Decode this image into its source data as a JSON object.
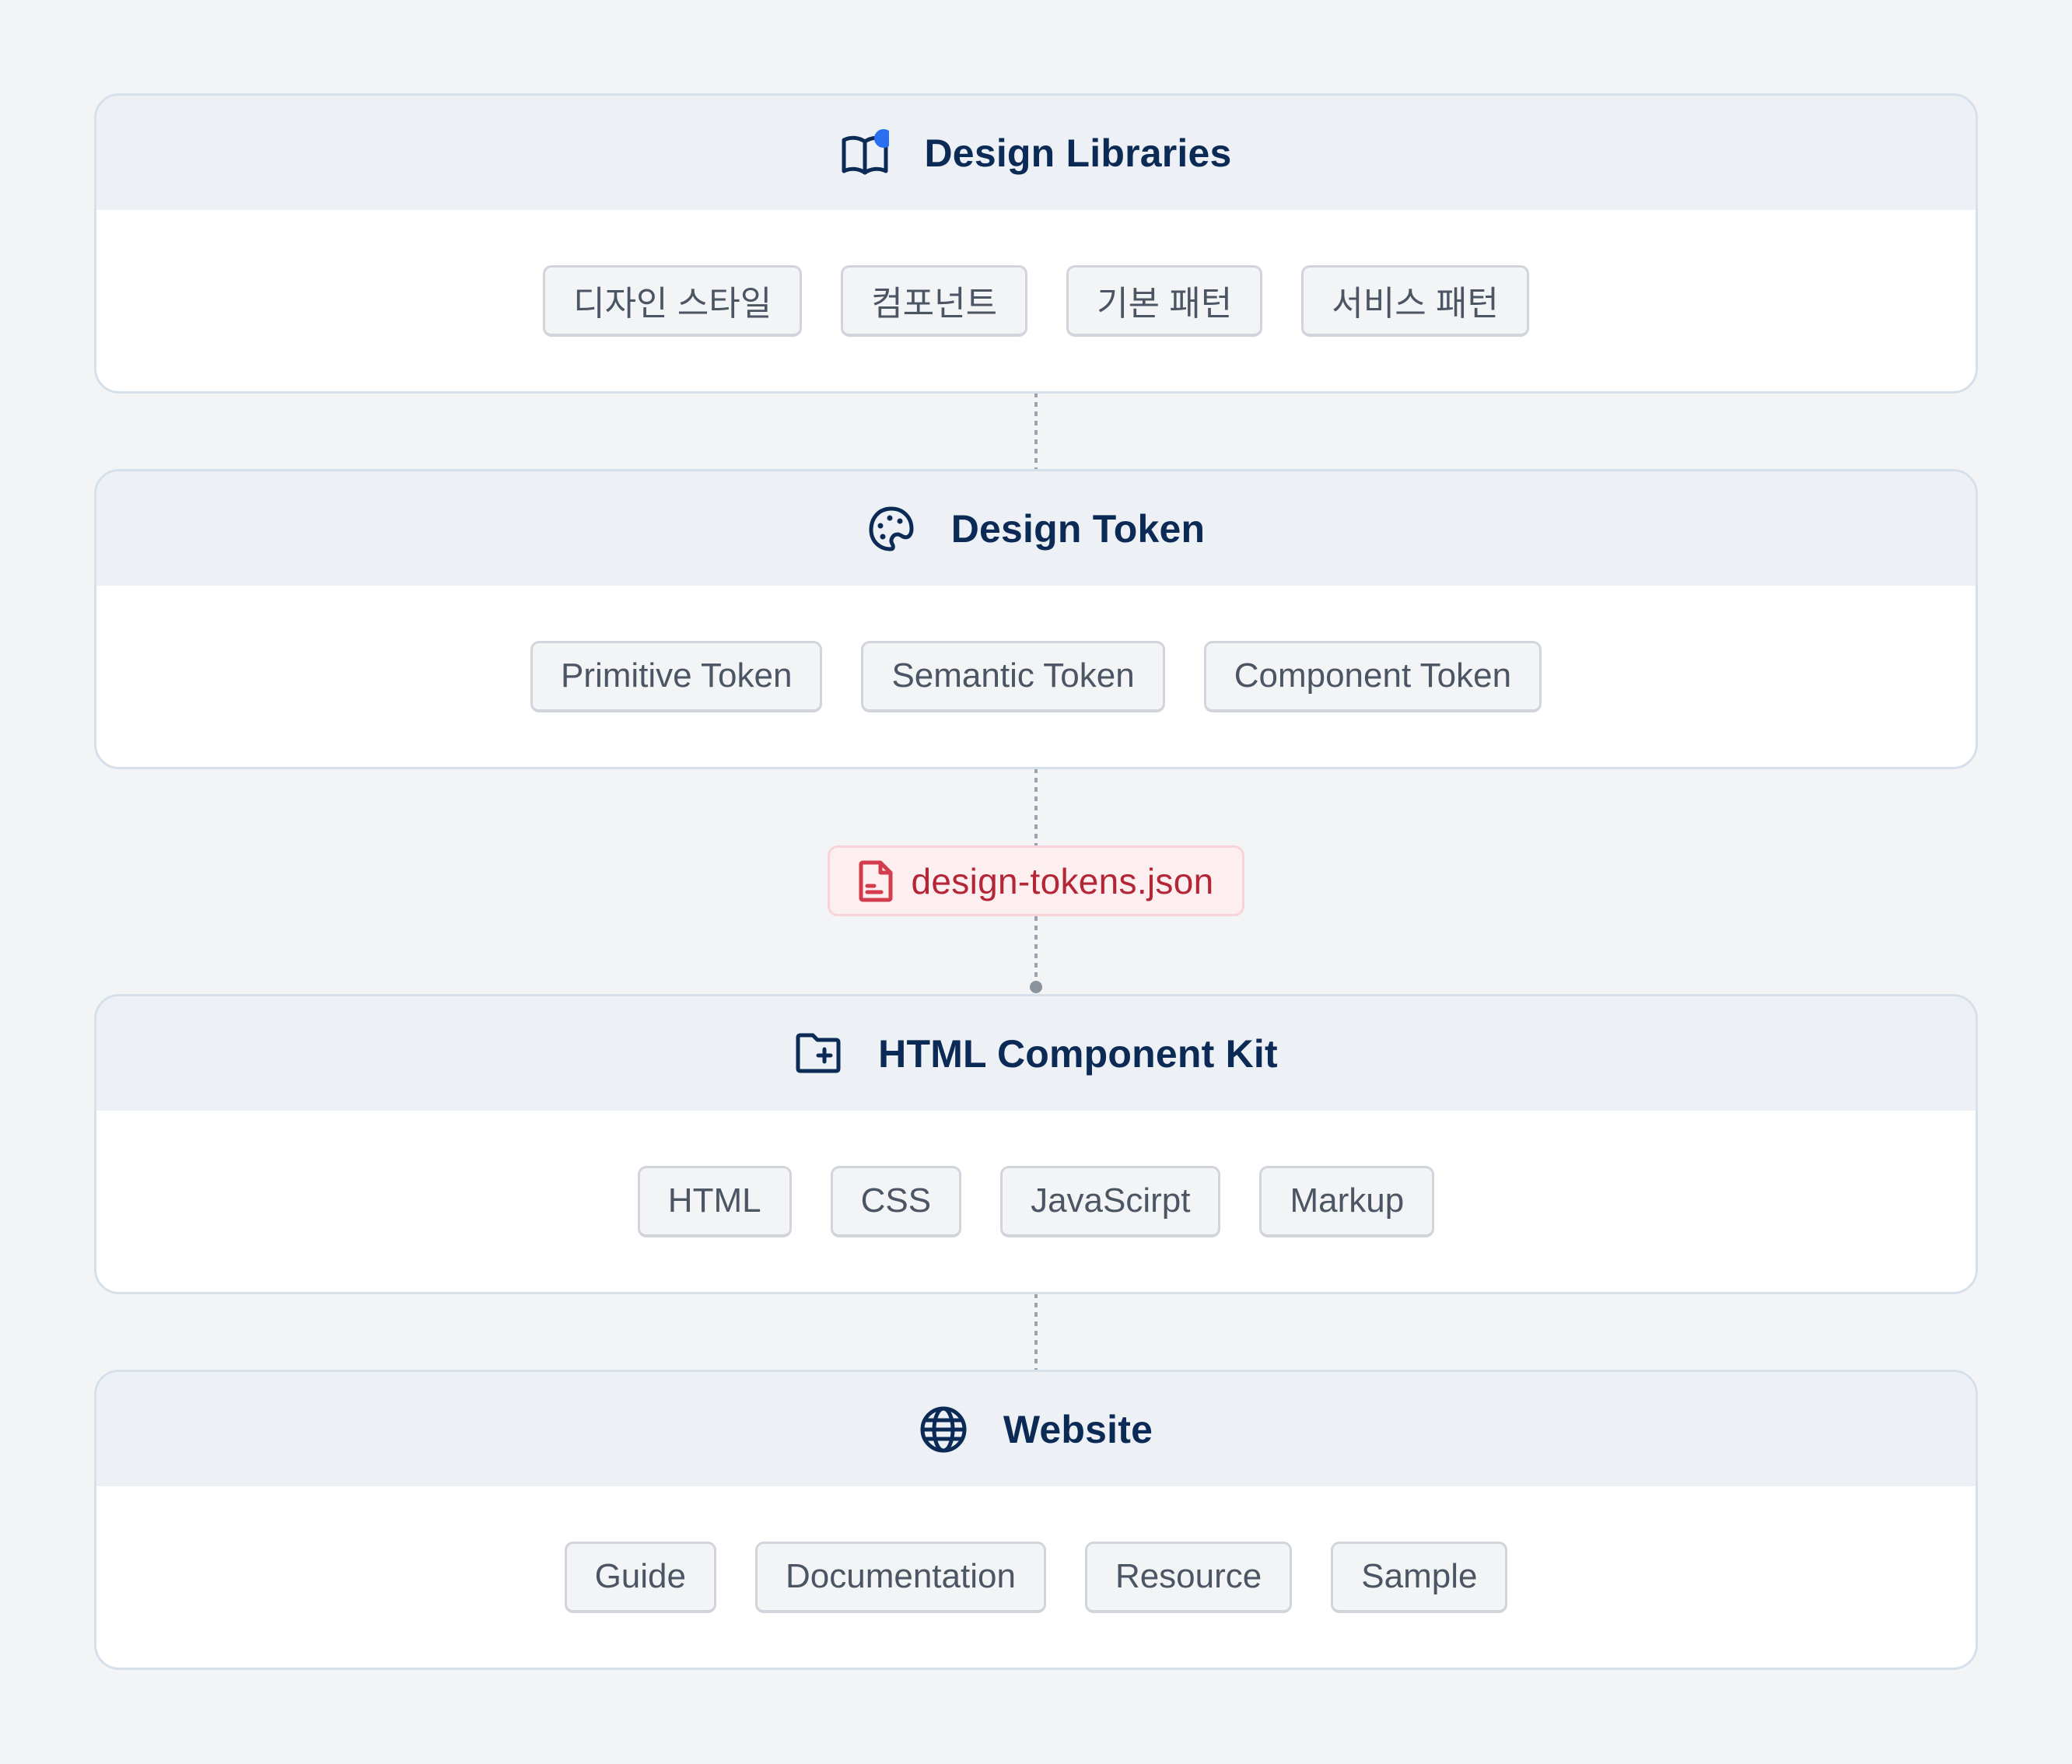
{
  "colors": {
    "background": "#f3f4f6",
    "card_header": "#edf1f6",
    "card_border": "#d6e0eb",
    "title_text": "#0b2a55",
    "tag_text": "#4b5563",
    "tag_bg": "#f3f4f6",
    "accent_dot": "#2a6ff0",
    "file_text": "#b42636",
    "file_bg": "#fdeeef",
    "connector": "#9ca3af"
  },
  "sections": [
    {
      "title": "Design Libraries",
      "icon": "book-open-icon",
      "tags": [
        "디자인 스타일",
        "컴포넌트",
        "기본 패턴",
        "서비스 패턴"
      ]
    },
    {
      "title": "Design Token",
      "icon": "palette-icon",
      "tags": [
        "Primitive Token",
        "Semantic Token",
        "Component Token"
      ]
    },
    {
      "title": "HTML Component Kit",
      "icon": "folder-plus-icon",
      "tags": [
        "HTML",
        "CSS",
        "JavaScirpt",
        "Markup"
      ]
    },
    {
      "title": "Website",
      "icon": "globe-icon",
      "tags": [
        "Guide",
        "Documentation",
        "Resource",
        "Sample"
      ]
    }
  ],
  "file_badge": {
    "icon": "file-text-icon",
    "label": "design-tokens.json"
  }
}
